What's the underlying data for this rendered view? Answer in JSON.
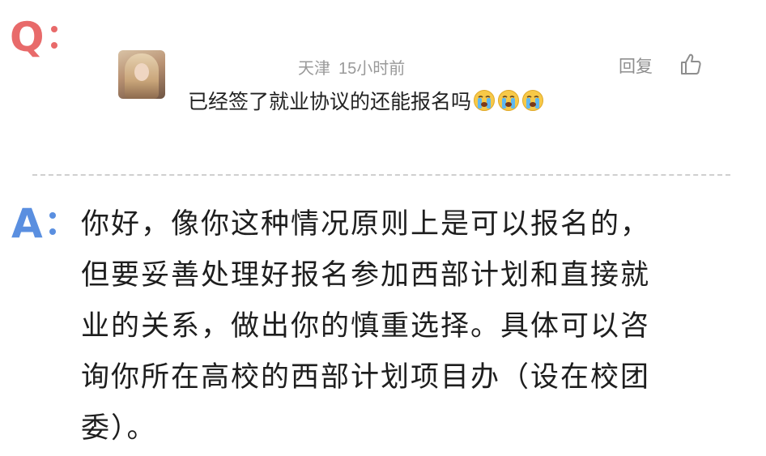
{
  "question": {
    "marker": "Q",
    "comment": {
      "author_location": "天津",
      "time": "15小时前",
      "reply_label": "回复",
      "text": "已经签了就业协议的还能报名吗",
      "emojis": [
        "crying-face",
        "crying-face",
        "crying-face"
      ]
    }
  },
  "answer": {
    "marker": "A",
    "lines": [
      "你好，像你这种情况原则上是可以报名的，",
      "但要妥善处理好报名参加西部计划和直接就",
      "业的关系，做出你的慎重选择。具体可以咨",
      "询你所在高校的西部计划项目办（设在校团",
      "委）。"
    ]
  },
  "colors": {
    "q_marker": "#e86a6a",
    "a_marker": "#5a8fe0",
    "meta_text": "#9a9a9a",
    "body_text": "#1e1e1e",
    "divider": "#cfcfcf"
  },
  "icons": [
    "thumbs-up-icon",
    "crying-face-emoji"
  ]
}
